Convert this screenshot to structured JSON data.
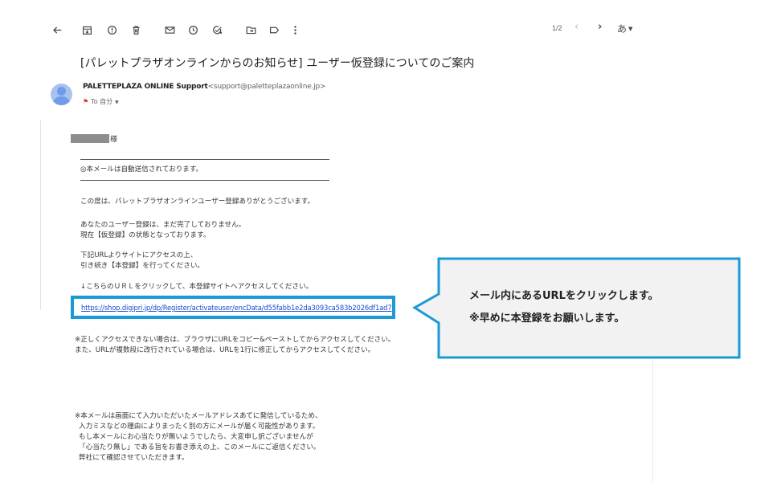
{
  "toolbar": {
    "back_icon": "arrow-left-icon",
    "archive_icon": "archive-icon",
    "report_icon": "report-spam-icon",
    "delete_icon": "trash-icon",
    "unread_icon": "mail-icon",
    "snooze_icon": "clock-icon",
    "task_icon": "add-task-icon",
    "move_icon": "folder-move-icon",
    "label_icon": "label-icon",
    "more_icon": "more-vert-icon",
    "pager": "1/2",
    "ime_label": "あ"
  },
  "email": {
    "subject": "[パレットプラザオンラインからのお知らせ] ユーザー仮登録についてのご案内",
    "sender_name": "PALETTEPLAZA ONLINE Support",
    "sender_email": "<support@paletteplazaonline.jp>",
    "to_label": "To 自分",
    "salutation": "様",
    "auto_notice": "◎本メールは自動送信されております。",
    "thanks": "この度は、パレットプラザオンラインユーザー登録ありがとうございます。",
    "incomplete_1": "あなたのユーザー登録は、まだ完了しておりません。",
    "incomplete_2": "現在【仮登録】の状態となっております。",
    "instruction_1": "下記URLよりサイトにアクセスの上、",
    "instruction_2": "引き続き【本登録】を行ってください。",
    "click_here": "↓こちらのＵＲＬをクリックして、本登録サイトへアクセスしてください。",
    "url": "https://shop.digipri.jp/dp/Register/activateuser/encData/d55fabb1e2da3093ca583b2026df1ad7",
    "note_1": "※正しくアクセスできない場合は、ブラウザにURLをコピー&ペーストしてからアクセスしてください。",
    "note_2": "また、URLが複数段に改行されている場合は、URLを1行に修正してからアクセスしてください。",
    "footer_1": "※本メールは画面にて入力いただいたメールアドレスあてに発信しているため、",
    "footer_2": "入力ミスなどの理由によりまったく別の方にメールが届く可能性があります。",
    "footer_3": "もし本メールにお心当たりが無いようでしたら、大変申し訳ございませんが",
    "footer_4": "「心当たり無し」である旨をお書き添えの上、このメールにご返信ください。",
    "footer_5": "弊社にて確認させていただきます。"
  },
  "callout": {
    "line_1": "メール内にあるURLをクリックします。",
    "line_2": "※早めに本登録をお願いします。",
    "border_color": "#1a9ad6",
    "fill_color": "#f2f2f2"
  }
}
